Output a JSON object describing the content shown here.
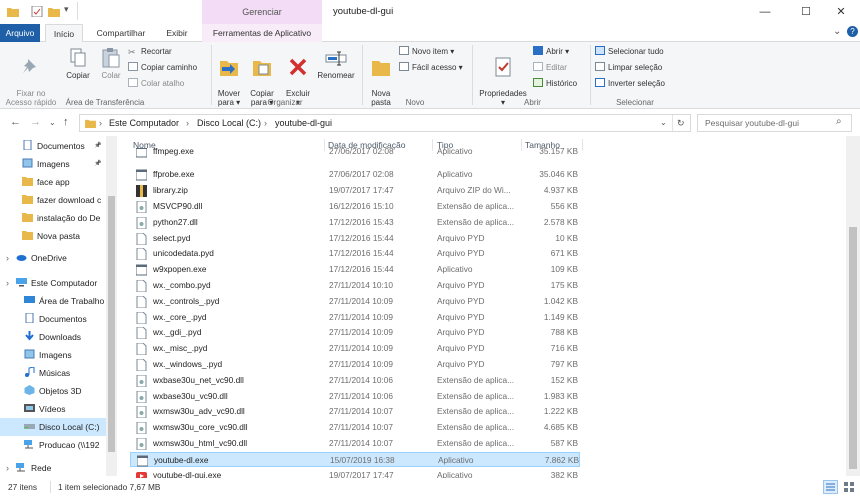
{
  "window": {
    "title": "youtube-dl-gui",
    "contextual_group": "Gerenciar",
    "controls": {
      "minimize": "—",
      "maximize": "☐",
      "close": "✕"
    }
  },
  "tabs": {
    "arquivo": "Arquivo",
    "inicio": "Início",
    "compartilhar": "Compartilhar",
    "exibir": "Exibir",
    "ferramentas": "Ferramentas de Aplicativo"
  },
  "ribbon": {
    "clipboard": {
      "fixar": "Fixar no\nAcesso rápido",
      "copiar": "Copiar",
      "colar": "Colar",
      "recortar": "Recortar",
      "copiar_caminho": "Copiar caminho",
      "colar_atalho": "Colar atalho",
      "group": "Área de Transferência"
    },
    "organize": {
      "mover": "Mover\npara ▾",
      "copiar_para": "Copiar\npara ▾",
      "excluir": "Excluir\n▾",
      "renomear": "Renomear",
      "group": "Organizar"
    },
    "new": {
      "nova_pasta": "Nova\npasta",
      "novo_item": "Novo item ▾",
      "facil_acesso": "Fácil acesso ▾",
      "group": "Novo"
    },
    "open": {
      "propriedades": "Propriedades\n▾",
      "abrir": "Abrir ▾",
      "editar": "Editar",
      "historico": "Histórico",
      "group": "Abrir"
    },
    "select": {
      "tudo": "Selecionar tudo",
      "limpar": "Limpar seleção",
      "inverter": "Inverter seleção",
      "group": "Selecionar"
    }
  },
  "address": {
    "crumbs": [
      "Este Computador",
      "Disco Local (C:)",
      "youtube-dl-gui"
    ],
    "search_placeholder": "Pesquisar youtube-dl-gui"
  },
  "nav": {
    "items": [
      "Documentos",
      "Imagens",
      "face app",
      "fazer download c",
      "instalação do De",
      "Nova pasta",
      "OneDrive",
      "Este Computador",
      "Área de Trabalho",
      "Documentos",
      "Downloads",
      "Imagens",
      "Músicas",
      "Objetos 3D",
      "Vídeos",
      "Disco Local (C:)",
      "Producao (\\\\192",
      "Rede"
    ]
  },
  "list": {
    "headers": {
      "name": "Nome",
      "date": "Data de modificação",
      "type": "Tipo",
      "size": "Tamanho"
    },
    "rows": [
      {
        "name": "ffmpeg.exe",
        "date": "27/06/2017 02:08",
        "type": "Aplicativo",
        "size": "35.157 KB",
        "icon": "exe"
      },
      {
        "name": "ffprobe.exe",
        "date": "27/06/2017 02:08",
        "type": "Aplicativo",
        "size": "35.046 KB",
        "icon": "exe"
      },
      {
        "name": "library.zip",
        "date": "19/07/2017 17:47",
        "type": "Arquivo ZIP do Wi...",
        "size": "4.937 KB",
        "icon": "zip"
      },
      {
        "name": "MSVCP90.dll",
        "date": "16/12/2016 15:10",
        "type": "Extensão de aplica...",
        "size": "556 KB",
        "icon": "dll"
      },
      {
        "name": "python27.dll",
        "date": "17/12/2016 15:43",
        "type": "Extensão de aplica...",
        "size": "2.578 KB",
        "icon": "dll"
      },
      {
        "name": "select.pyd",
        "date": "17/12/2016 15:44",
        "type": "Arquivo PYD",
        "size": "10 KB",
        "icon": "file"
      },
      {
        "name": "unicodedata.pyd",
        "date": "17/12/2016 15:44",
        "type": "Arquivo PYD",
        "size": "671 KB",
        "icon": "file"
      },
      {
        "name": "w9xpopen.exe",
        "date": "17/12/2016 15:44",
        "type": "Aplicativo",
        "size": "109 KB",
        "icon": "exe"
      },
      {
        "name": "wx._combo.pyd",
        "date": "27/11/2014 10:10",
        "type": "Arquivo PYD",
        "size": "175 KB",
        "icon": "file"
      },
      {
        "name": "wx._controls_.pyd",
        "date": "27/11/2014 10:09",
        "type": "Arquivo PYD",
        "size": "1.042 KB",
        "icon": "file"
      },
      {
        "name": "wx._core_.pyd",
        "date": "27/11/2014 10:09",
        "type": "Arquivo PYD",
        "size": "1.149 KB",
        "icon": "file"
      },
      {
        "name": "wx._gdi_.pyd",
        "date": "27/11/2014 10:09",
        "type": "Arquivo PYD",
        "size": "788 KB",
        "icon": "file"
      },
      {
        "name": "wx._misc_.pyd",
        "date": "27/11/2014 10:09",
        "type": "Arquivo PYD",
        "size": "716 KB",
        "icon": "file"
      },
      {
        "name": "wx._windows_.pyd",
        "date": "27/11/2014 10:09",
        "type": "Arquivo PYD",
        "size": "797 KB",
        "icon": "file"
      },
      {
        "name": "wxbase30u_net_vc90.dll",
        "date": "27/11/2014 10:06",
        "type": "Extensão de aplica...",
        "size": "152 KB",
        "icon": "dll"
      },
      {
        "name": "wxbase30u_vc90.dll",
        "date": "27/11/2014 10:06",
        "type": "Extensão de aplica...",
        "size": "1.983 KB",
        "icon": "dll"
      },
      {
        "name": "wxmsw30u_adv_vc90.dll",
        "date": "27/11/2014 10:07",
        "type": "Extensão de aplica...",
        "size": "1.222 KB",
        "icon": "dll"
      },
      {
        "name": "wxmsw30u_core_vc90.dll",
        "date": "27/11/2014 10:07",
        "type": "Extensão de aplica...",
        "size": "4.685 KB",
        "icon": "dll"
      },
      {
        "name": "wxmsw30u_html_vc90.dll",
        "date": "27/11/2014 10:07",
        "type": "Extensão de aplica...",
        "size": "587 KB",
        "icon": "dll"
      },
      {
        "name": "youtube-dl.exe",
        "date": "15/07/2019 16:38",
        "type": "Aplicativo",
        "size": "7.862 KB",
        "icon": "exe",
        "selected": true
      },
      {
        "name": "youtube-dl-gui.exe",
        "date": "19/07/2017 17:47",
        "type": "Aplicativo",
        "size": "382 KB",
        "icon": "yt"
      }
    ]
  },
  "status": {
    "count": "27 itens",
    "selection": "1 item selecionado  7,67 MB"
  },
  "colors": {
    "accent": "#1f5fa8",
    "selection": "#cce8ff",
    "contextual": "#f3dcf5"
  }
}
